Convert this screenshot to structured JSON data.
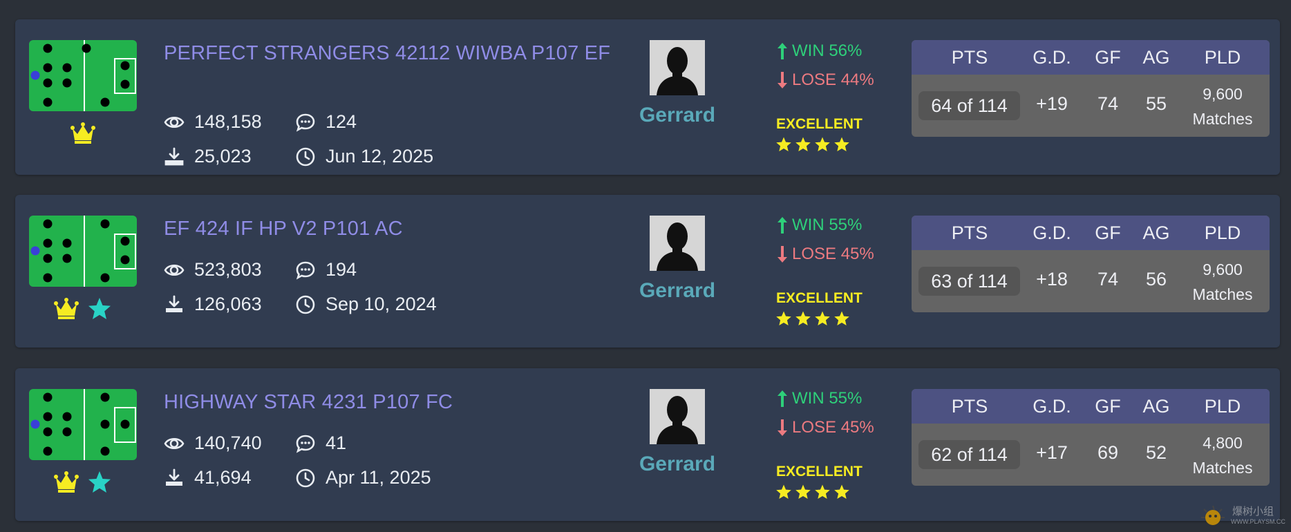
{
  "colors": {
    "background": "#2b3038",
    "card": "#313c50",
    "title": "#8f8ce6",
    "player": "#5aa9b9",
    "win": "#2ed07a",
    "lose": "#ec7a80",
    "rating": "#f6ec22",
    "table_header": "#4d5282",
    "table_body": "#646464",
    "pitch": "#22b24c"
  },
  "table_headers": [
    "PTS",
    "G.D.",
    "GF",
    "AG",
    "PLD"
  ],
  "items": [
    {
      "title": "PERFECT STRANGERS 42112 WIWBA P107 EF",
      "badges": [
        "crown-icon"
      ],
      "views": "148,158",
      "comments": "124",
      "downloads": "25,023",
      "date": "Jun 12, 2025",
      "player": "Gerrard",
      "win": "WIN 56%",
      "lose": "LOSE 44%",
      "rating": "EXCELLENT",
      "stars": 4,
      "pts": "64 of 114",
      "gd": "+19",
      "gf": "74",
      "ag": "55",
      "pld_count": "9,600",
      "pld_unit": "Matches"
    },
    {
      "title": "EF 424 IF HP V2 P101 AC",
      "badges": [
        "crown-icon",
        "star-icon"
      ],
      "views": "523,803",
      "comments": "194",
      "downloads": "126,063",
      "date": "Sep 10, 2024",
      "player": "Gerrard",
      "win": "WIN 55%",
      "lose": "LOSE 45%",
      "rating": "EXCELLENT",
      "stars": 4,
      "pts": "63 of 114",
      "gd": "+18",
      "gf": "74",
      "ag": "56",
      "pld_count": "9,600",
      "pld_unit": "Matches"
    },
    {
      "title": "HIGHWAY STAR 4231 P107 FC",
      "badges": [
        "crown-icon",
        "star-icon"
      ],
      "views": "140,740",
      "comments": "41",
      "downloads": "41,694",
      "date": "Apr 11, 2025",
      "player": "Gerrard",
      "win": "WIN 55%",
      "lose": "LOSE 45%",
      "rating": "EXCELLENT",
      "stars": 4,
      "pts": "62 of 114",
      "gd": "+17",
      "gf": "69",
      "ag": "52",
      "pld_count": "4,800",
      "pld_unit": "Matches"
    }
  ],
  "watermark": {
    "text": "爆树小组",
    "url": "WWW.PLAYSM.CC"
  }
}
